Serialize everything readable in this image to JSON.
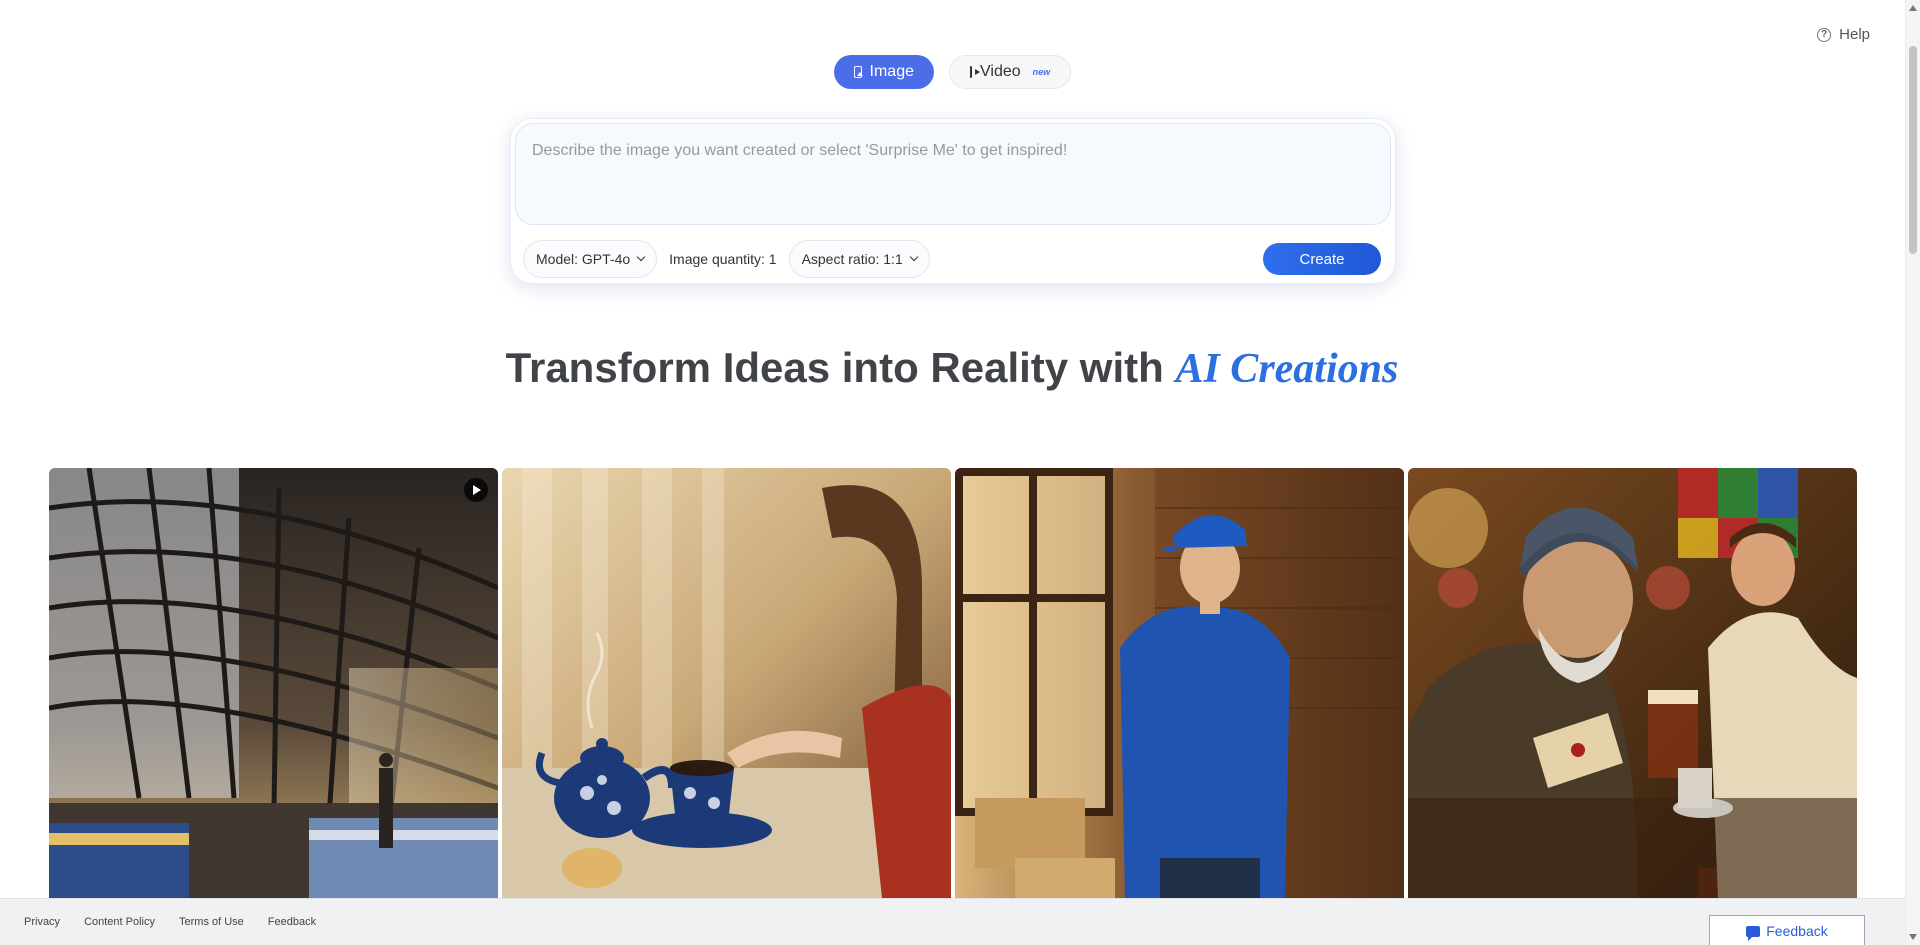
{
  "header": {
    "help_label": "Help",
    "help_icon": "question-circle-icon"
  },
  "mode_tabs": [
    {
      "label": "Image",
      "icon": "image-icon",
      "active": true
    },
    {
      "label": "Video",
      "icon": "video-icon",
      "badge": "new",
      "active": false
    }
  ],
  "prompt": {
    "placeholder": "Describe the image you want created or select 'Surprise Me' to get inspired!"
  },
  "controls": {
    "model_label": "Model: GPT-4o",
    "quantity_label": "Image quantity: 1",
    "aspect_label": "Aspect ratio: 1:1",
    "create_label": "Create"
  },
  "headline": {
    "text": "Transform Ideas into Reality with",
    "accent": "AI Creations"
  },
  "gallery": {
    "items": [
      {
        "subject": "train-station",
        "has_video": true
      },
      {
        "subject": "teapot-tea-cup",
        "has_video": false
      },
      {
        "subject": "man-blue-jacket-window",
        "has_video": false
      },
      {
        "subject": "old-man-pub-letter",
        "has_video": false
      }
    ]
  },
  "footer": {
    "links": [
      "Privacy",
      "Content Policy",
      "Terms of Use",
      "Feedback"
    ],
    "feedback_button": "Feedback"
  },
  "colors": {
    "accent": "#4b6ee8",
    "create_button": "#2f6fee",
    "headline_accent": "#2b6fe0",
    "footer_bg": "#f0f1f3"
  }
}
